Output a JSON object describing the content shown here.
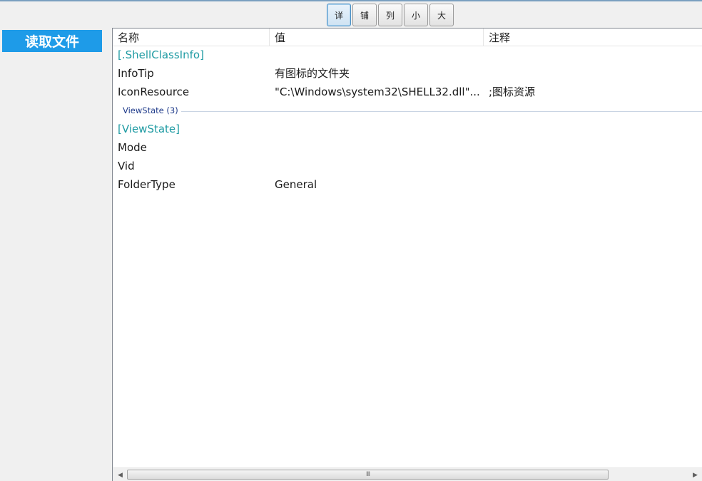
{
  "toolbar": {
    "views": [
      {
        "label": "详",
        "active": true
      },
      {
        "label": "铺",
        "active": false
      },
      {
        "label": "列",
        "active": false
      },
      {
        "label": "小",
        "active": false
      },
      {
        "label": "大",
        "active": false
      }
    ]
  },
  "sidebar": {
    "read_file_label": "读取文件"
  },
  "table": {
    "columns": [
      "名称",
      "值",
      "注释"
    ],
    "rows": [
      {
        "name": "[.ShellClassInfo]",
        "value": "",
        "comment": "",
        "section": true
      },
      {
        "name": "InfoTip",
        "value": "有图标的文件夹",
        "comment": ""
      },
      {
        "name": "IconResource",
        "value": "\"C:\\Windows\\system32\\SHELL32.dll\"...",
        "comment": ";图标资源"
      },
      {
        "name": "[ViewState]",
        "value": "",
        "comment": "",
        "section": true
      },
      {
        "name": "Mode",
        "value": "",
        "comment": ""
      },
      {
        "name": "Vid",
        "value": "",
        "comment": ""
      },
      {
        "name": "FolderType",
        "value": "General",
        "comment": ""
      }
    ],
    "group_label": "ViewState (3)"
  },
  "scrollbar": {
    "grip": "III"
  },
  "colors": {
    "accent": "#1e9be8",
    "section_text": "#1f9ba3",
    "group_text": "#1e3a8a"
  }
}
